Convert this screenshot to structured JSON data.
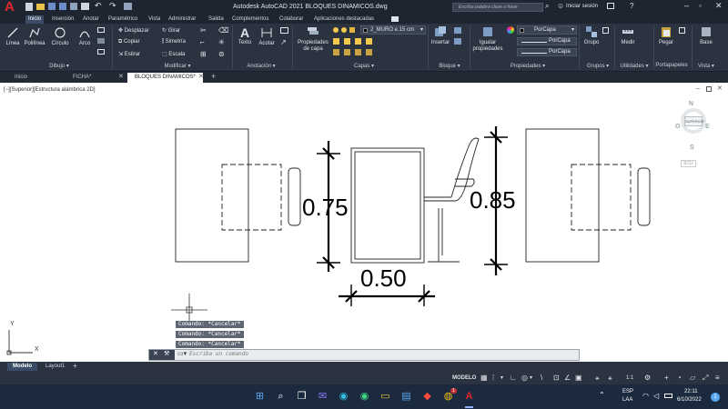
{
  "app": {
    "title": "Autodesk AutoCAD 2021   BLOQUES DINAMICOS.dwg",
    "logo": "A",
    "search_placeholder": "Escriba palabra clave o frase",
    "signin": "Iniciar sesión"
  },
  "ribbon_tabs": [
    "Inicio",
    "Inserción",
    "Anotar",
    "Paramétrico",
    "Vista",
    "Administrar",
    "Salida",
    "Complementos",
    "Colaborar",
    "Aplicaciones destacadas"
  ],
  "ribbon": {
    "draw": {
      "line": "Línea",
      "polyline": "Polilínea",
      "circle": "Círculo",
      "arc": "Arco",
      "label": "Dibujo ▾"
    },
    "modify": {
      "move": "Desplazar",
      "copy": "Copiar",
      "stretch": "Estirar",
      "rotate": "Girar",
      "mirror": "Simetría",
      "scale": "Escala",
      "label": "Modificar ▾"
    },
    "annotation": {
      "text": "Texto",
      "dimension": "Acotar",
      "label": "Anotación ▾"
    },
    "layers": {
      "props": "Propiedades de capa",
      "current": "2_MURO e.15 cm",
      "label": "Capas ▾"
    },
    "block": {
      "insert": "Insertar",
      "label": "Bloque ▾"
    },
    "properties": {
      "match": "Igualar propiedades",
      "color": "PorCapa",
      "linetype": "PorCapa",
      "lineweight": "PorCapa",
      "label": "Propiedades ▾"
    },
    "groups": {
      "group": "Grupo",
      "label": "Grupos ▾"
    },
    "utilities": {
      "measure": "Medir",
      "label": "Utilidades ▾"
    },
    "clipboard": {
      "paste": "Pegar",
      "label": "Portapapeles"
    },
    "view": {
      "base": "Base",
      "label": "Vista ▾"
    }
  },
  "file_tabs": [
    "Inicio",
    "FICHA*",
    "BLOQUES DINAMICOS*"
  ],
  "viewport": {
    "label": "[−][Superior][Estructura alámbrica 2D]",
    "viewcube": {
      "top": "SUPERIOR",
      "n": "N",
      "s": "S",
      "o": "O",
      "e": "E",
      "ucs": "SCU"
    },
    "dims": [
      "0.75",
      "0.85",
      "0.50"
    ]
  },
  "command": {
    "history": [
      "Comando: *Cancelar*",
      "Comando: *Cancelar*",
      "Comando: *Cancelar*"
    ],
    "placeholder": "Escriba un comando"
  },
  "layout_tabs": [
    "Modelo",
    "Layout1",
    "+"
  ],
  "status": {
    "model": "MODELO",
    "scale": "1:1"
  },
  "taskbar": {
    "lang1": "ESP",
    "lang2": "LAA",
    "time": "22:11",
    "date": "6/10/2022",
    "badge": "1",
    "chrome_badge": "1"
  }
}
